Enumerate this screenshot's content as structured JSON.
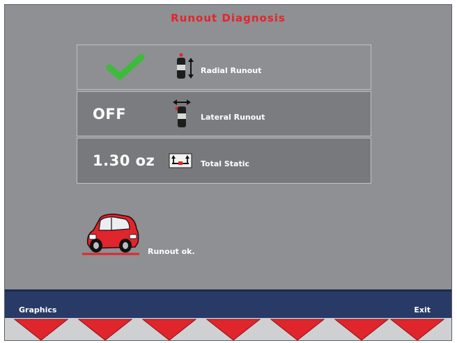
{
  "screen": {
    "title": "Runout Diagnosis"
  },
  "rows": [
    {
      "value": "",
      "label": "Radial Runout",
      "status_icon": "check-icon",
      "icon": "radial-runout-wheel-icon"
    },
    {
      "value": "OFF",
      "label": "Lateral Runout",
      "icon": "lateral-runout-wheel-icon"
    },
    {
      "value": "1.30 oz",
      "label": "Total Static",
      "icon": "static-weight-icon"
    }
  ],
  "status": {
    "icon": "car-icon",
    "text": "Runout ok."
  },
  "softkeys": {
    "left_label": "Graphics",
    "right_label": "Exit",
    "count": 7,
    "icon": "down-arrow-icon"
  },
  "colors": {
    "title": "#e8232b",
    "check": "#3dbb3a",
    "key_arrow": "#e0252c",
    "softbar": "#283a66",
    "background": "#8e9093"
  }
}
